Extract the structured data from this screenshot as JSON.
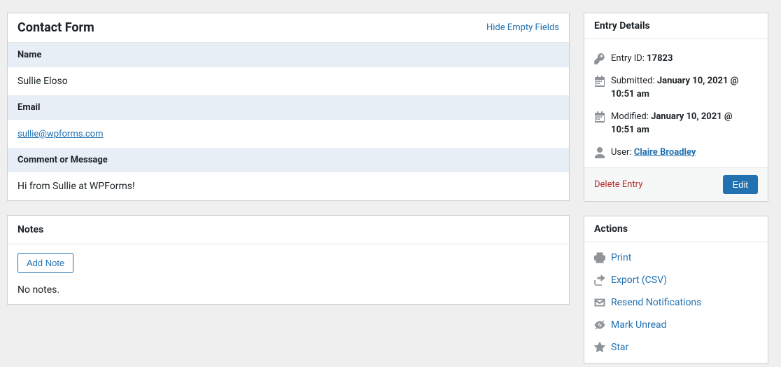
{
  "form": {
    "title": "Contact Form",
    "hide_empty_label": "Hide Empty Fields",
    "fields": [
      {
        "label": "Name",
        "value": "Sullie Eloso",
        "is_link": false
      },
      {
        "label": "Email",
        "value": "sullie@wpforms.com",
        "is_link": true
      },
      {
        "label": "Comment or Message",
        "value": "Hi from Sullie at WPForms!",
        "is_link": false
      }
    ]
  },
  "notes": {
    "title": "Notes",
    "add_button": "Add Note",
    "empty_text": "No notes."
  },
  "details": {
    "title": "Entry Details",
    "entry_id_label": "Entry ID:",
    "entry_id_value": "17823",
    "submitted_label": "Submitted:",
    "submitted_value": "January 10, 2021 @ 10:51 am",
    "modified_label": "Modified:",
    "modified_value": "January 10, 2021 @ 10:51 am",
    "user_label": "User:",
    "user_value": "Claire Broadley",
    "delete_label": "Delete Entry",
    "edit_label": "Edit"
  },
  "actions": {
    "title": "Actions",
    "items": [
      {
        "icon": "print-icon",
        "label": "Print"
      },
      {
        "icon": "export-icon",
        "label": "Export (CSV)"
      },
      {
        "icon": "mail-icon",
        "label": "Resend Notifications"
      },
      {
        "icon": "eye-slash-icon",
        "label": "Mark Unread"
      },
      {
        "icon": "star-icon",
        "label": "Star"
      }
    ]
  }
}
